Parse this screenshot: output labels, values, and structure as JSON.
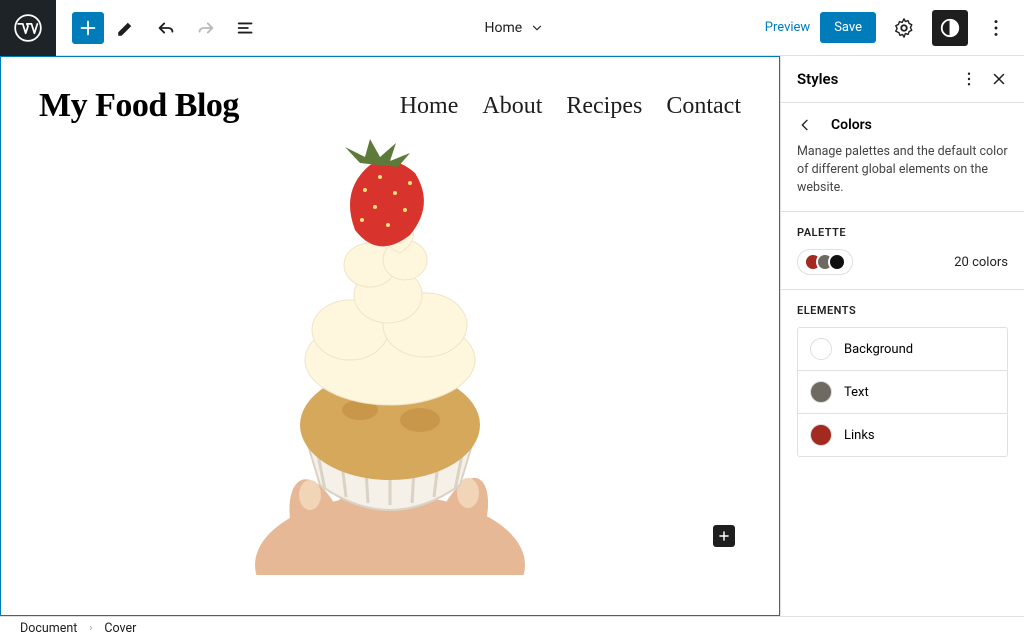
{
  "toolbar": {
    "page_title": "Home",
    "preview": "Preview",
    "save": "Save"
  },
  "canvas": {
    "site_title": "My Food Blog",
    "nav": [
      "Home",
      "About",
      "Recipes",
      "Contact"
    ]
  },
  "sidebar": {
    "panel_title": "Styles",
    "section_title": "Colors",
    "description": "Manage palettes and the default color of different global elements on the website.",
    "palette_label": "PALETTE",
    "palette_count": "20 colors",
    "palette_swatches": [
      "#A32A1F",
      "#6E6A61",
      "#0F0F0F"
    ],
    "elements_label": "ELEMENTS",
    "elements": [
      {
        "label": "Background",
        "color": "#FFFFFF"
      },
      {
        "label": "Text",
        "color": "#6E6A61"
      },
      {
        "label": "Links",
        "color": "#A32A1F"
      }
    ]
  },
  "breadcrumb": [
    "Document",
    "Cover"
  ]
}
